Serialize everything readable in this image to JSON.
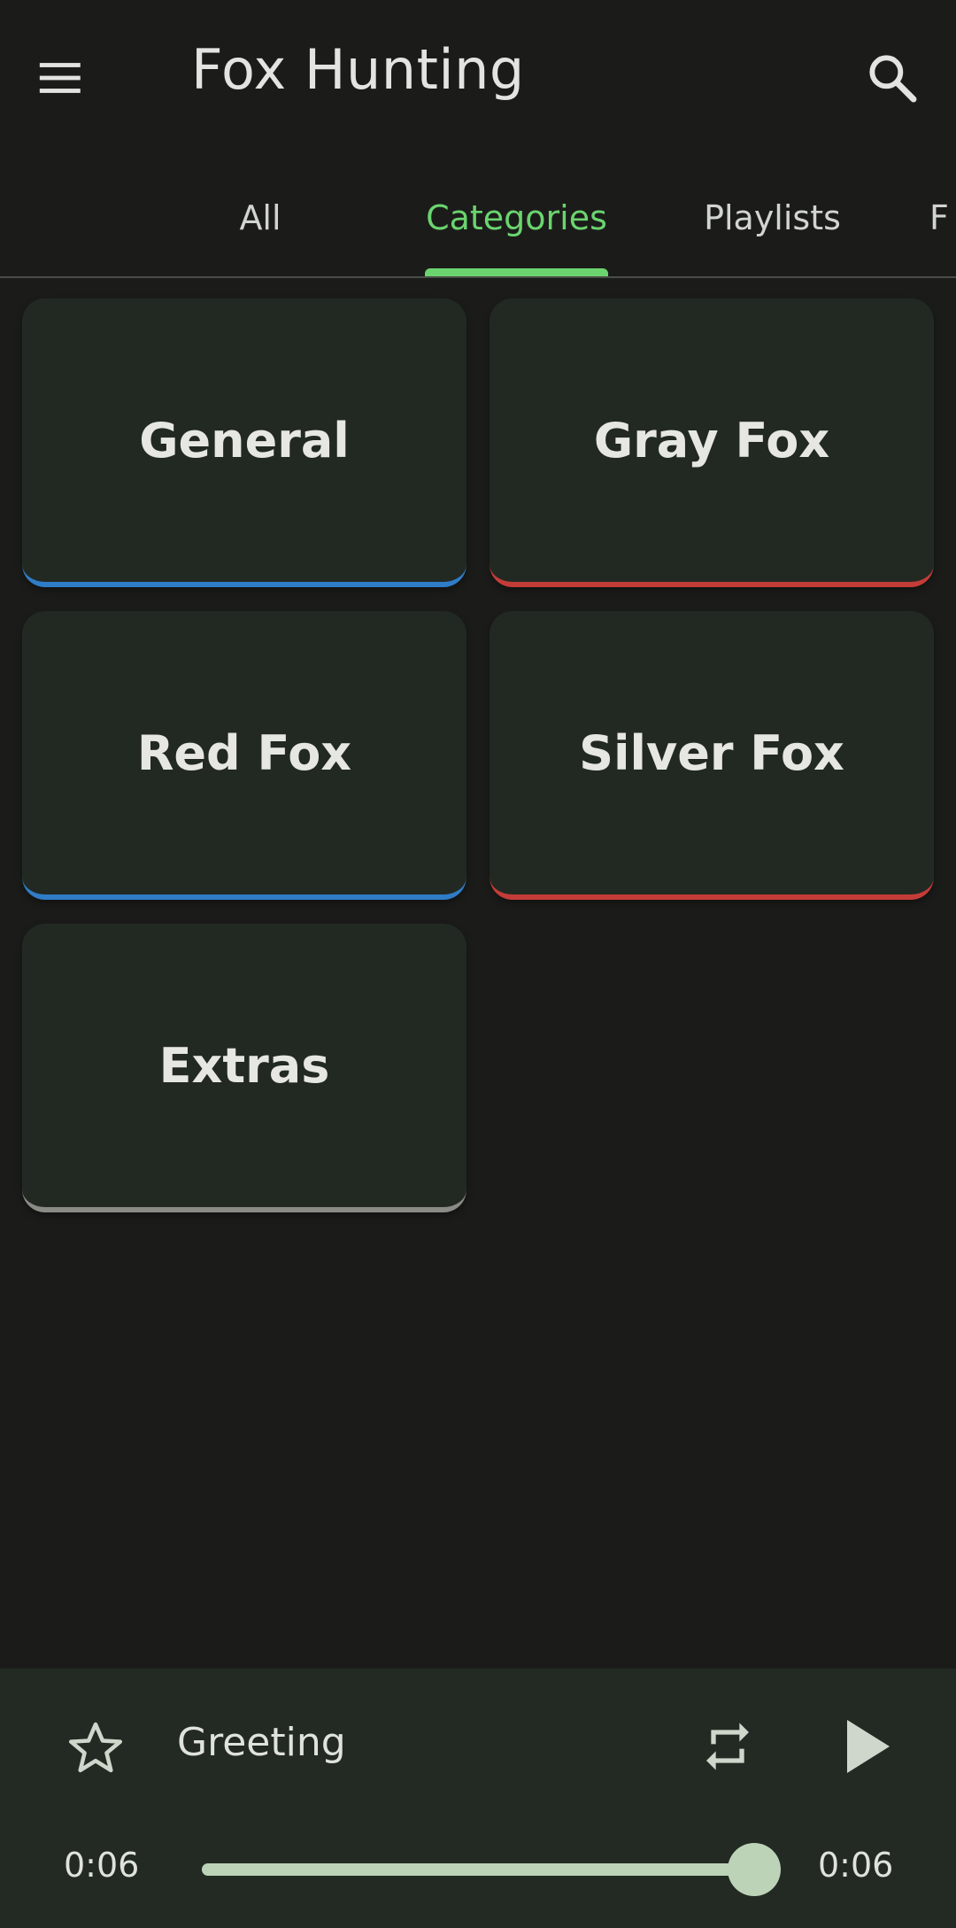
{
  "appbar": {
    "title": "Fox Hunting",
    "menu_icon": "hamburger-menu-icon",
    "search_icon": "search-icon"
  },
  "tabs": [
    {
      "label": "All",
      "active": false
    },
    {
      "label": "Categories",
      "active": true
    },
    {
      "label": "Playlists",
      "active": false
    },
    {
      "label": "F",
      "active": false
    }
  ],
  "categories": [
    {
      "label": "General",
      "accent": "#2f7cc7"
    },
    {
      "label": "Gray Fox",
      "accent": "#c43c38"
    },
    {
      "label": "Red Fox",
      "accent": "#2f7cc7"
    },
    {
      "label": "Silver Fox",
      "accent": "#c43c38"
    },
    {
      "label": "Extras",
      "accent": "#8a8b86"
    }
  ],
  "player": {
    "track_title": "Greeting",
    "elapsed": "0:06",
    "duration": "0:06",
    "progress": 1.0,
    "favorite_icon": "star-outline-icon",
    "repeat_icon": "repeat-icon",
    "play_icon": "play-icon"
  },
  "colors": {
    "background": "#1b1c1a",
    "accent_green": "#6bd46f",
    "card_bg": "#222922",
    "player_bg": "#232a23"
  }
}
